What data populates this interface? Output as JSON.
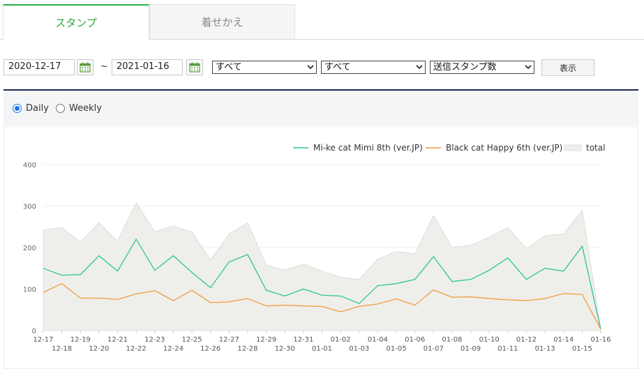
{
  "tabs": [
    {
      "label": "スタンプ",
      "active": true
    },
    {
      "label": "着せかえ",
      "active": false
    }
  ],
  "filters": {
    "start_date": "2020-12-17",
    "end_date": "2021-01-16",
    "tilde": "~",
    "select1": "すべて",
    "select2": "すべて",
    "select3": "送信スタンプ数",
    "show_button": "表示"
  },
  "period": {
    "options": [
      "Daily",
      "Weekly"
    ],
    "selected": "Daily"
  },
  "colors": {
    "accent_green": "#2db04b",
    "series_green": "#2ec785",
    "series_orange": "#f39a3a",
    "total_fill": "#eeefeb",
    "total_stroke": "#dcdcdc",
    "divider": "#1e2a55"
  },
  "chart_data": {
    "type": "line",
    "ylim": [
      0,
      400
    ],
    "yticks": [
      0,
      100,
      200,
      300,
      400
    ],
    "x": [
      "12-17",
      "12-18",
      "12-19",
      "12-20",
      "12-21",
      "12-22",
      "12-23",
      "12-24",
      "12-25",
      "12-26",
      "12-27",
      "12-28",
      "12-29",
      "12-30",
      "12-31",
      "01-01",
      "01-02",
      "01-03",
      "01-04",
      "01-05",
      "01-06",
      "01-07",
      "01-08",
      "01-09",
      "01-10",
      "01-11",
      "01-12",
      "01-13",
      "01-14",
      "01-15",
      "01-16"
    ],
    "series": [
      {
        "name": "Mi-ke cat Mimi 8th (ver.JP)",
        "type": "line",
        "color": "#2ec785",
        "values": [
          150,
          133,
          135,
          180,
          143,
          220,
          145,
          180,
          140,
          103,
          165,
          183,
          97,
          83,
          100,
          85,
          83,
          65,
          108,
          113,
          123,
          178,
          118,
          123,
          145,
          175,
          123,
          150,
          143,
          203,
          3
        ]
      },
      {
        "name": "Black cat Happy 6th (ver.JP)",
        "type": "line",
        "color": "#f39a3a",
        "values": [
          92,
          113,
          78,
          78,
          75,
          88,
          96,
          72,
          97,
          67,
          69,
          77,
          59,
          61,
          59,
          58,
          45,
          58,
          64,
          76,
          61,
          98,
          80,
          81,
          77,
          74,
          72,
          77,
          89,
          87,
          3
        ]
      },
      {
        "name": "total",
        "type": "area",
        "color": "#eeefeb",
        "values": [
          242,
          248,
          213,
          260,
          215,
          308,
          238,
          252,
          237,
          170,
          232,
          260,
          157,
          145,
          160,
          143,
          128,
          123,
          172,
          190,
          185,
          277,
          200,
          205,
          225,
          248,
          197,
          228,
          233,
          290,
          5
        ]
      }
    ]
  }
}
